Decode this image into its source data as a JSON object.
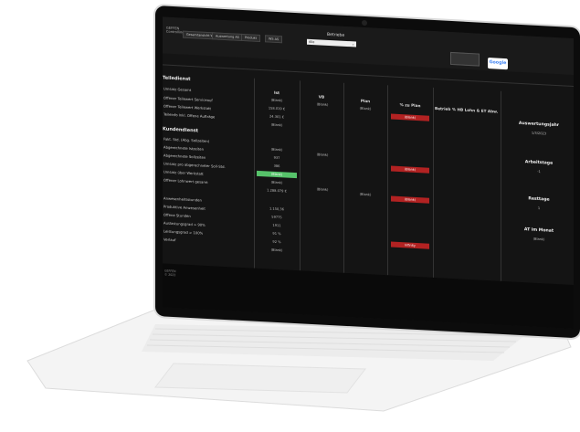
{
  "app": {
    "logo_line1": "GEFFEN",
    "logo_line2": "Controlling"
  },
  "toolbar": {
    "buttons": [
      "Gesamtansicht WS",
      "Auswertung AS",
      "Produkt",
      "WS AS"
    ]
  },
  "filter": {
    "betriebe_label": "Betriebe",
    "betriebe_value": "Alle"
  },
  "google_label": "Google",
  "sections": {
    "teiledienst": "Teiledienst",
    "kundendienst": "Kundendienst"
  },
  "columns": {
    "ist": "Ist",
    "vb": "VB",
    "plan": "Plan",
    "zu_plan": "% zu Plan",
    "right_head": "Betrieb % HB Lohn & ET Abw."
  },
  "rows": {
    "teile": [
      {
        "label": "Umsatz Gesamt",
        "ist": "(Blank)",
        "vb": "(Blank)",
        "plan": "(Blank)",
        "zu_plan": "(Blank)"
      },
      {
        "label": "Offener Teilewert Serviceauf",
        "ist": "158.019 €"
      },
      {
        "label": "Offener Teilewert Werkstatt",
        "ist": "24.301 €"
      },
      {
        "label": "Teileinfo Inkl. Offene Aufträge",
        "ist": "(Blank)"
      }
    ],
    "kunden": [
      {
        "label": "Fakt. Std. (Abg. Sollzeiten)",
        "ist": "(Blank)",
        "vb": "(Blank)"
      },
      {
        "label": "Abgerechnete Istzeiten",
        "ist": "937",
        "zu_plan": "(Blank)"
      },
      {
        "label": "Abgerechnete Sollzeiten",
        "ist": "386"
      },
      {
        "label": "Umsatz pro abgerechneter Soll-Std.",
        "ist": "(Blank)"
      },
      {
        "label": "Umsatz über Werkstatt",
        "ist": "(Blank)",
        "vb": "(Blank)",
        "plan": "(Blank)",
        "zu_plan": "(Blank)"
      },
      {
        "label": "Offener Lohnwert gesamt",
        "ist": "1.288.079 €"
      },
      {
        "label": "Anwesenheitsstunden",
        "ist": "1.150,36"
      },
      {
        "label": "Produktive Anwesenheit",
        "ist": "59775"
      },
      {
        "label": "Offene Stunden",
        "ist": "1911"
      },
      {
        "label": "Auslastungsgrad > 90%",
        "ist": "91 %",
        "zu_plan": "Infinity"
      },
      {
        "label": "Leistungsgrad > 100%",
        "ist": "92 %"
      },
      {
        "label": "Verlauf",
        "ist": "(Blank)"
      }
    ]
  },
  "right_panel": [
    {
      "title": "Auswertungsjahr",
      "value": "1/3/2023"
    },
    {
      "title": "Arbeitstage",
      "value": "-1"
    },
    {
      "title": "Resttage",
      "value": "1"
    },
    {
      "title": "AT im Monat",
      "value": "(Blank)"
    }
  ],
  "footer": {
    "line1": "GEFFEN",
    "line2": "© 2023"
  },
  "colors": {
    "alert": "#b22222",
    "good": "#56c26a"
  }
}
